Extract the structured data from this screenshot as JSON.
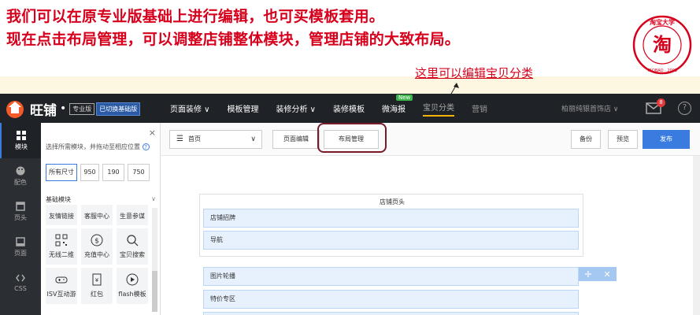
{
  "slide": {
    "line1": "我们可以在原专业版基础上进行编辑，也可买模板套用。",
    "line2": "现在点击布局管理，可以调整店铺整体模块，管理店铺的大致布局。",
    "annotation": "这里可以编辑宝贝分类",
    "seal_text_top": "淘宝大学",
    "seal_text_side": "UNIVERSITY",
    "seal_text_bottom": "TAOBAO · 2003",
    "seal_char": "淘"
  },
  "topnav": {
    "logo": "旺铺",
    "dot": "•",
    "tag_pro": "专业版",
    "tag_base": "已切换基础版",
    "items": [
      {
        "label": "页面装修 ∨"
      },
      {
        "label": "模板管理"
      },
      {
        "label": "装修分析 ∨"
      },
      {
        "label": "装修模板"
      },
      {
        "label": "微海报",
        "badge": "New"
      },
      {
        "label": "宝贝分类"
      },
      {
        "label": "营销"
      }
    ],
    "shop_name": "柏丽纯银首饰店 ∨",
    "mail_count": "8",
    "help": "?"
  },
  "rail": {
    "items": [
      {
        "label": "模块",
        "icon": "grid-icon"
      },
      {
        "label": "配色",
        "icon": "palette-icon"
      },
      {
        "label": "页头",
        "icon": "header-icon"
      },
      {
        "label": "页面",
        "icon": "page-icon"
      },
      {
        "label": "CSS",
        "icon": "code-icon"
      }
    ]
  },
  "panel": {
    "close": "×",
    "hint": "选择所需模块，并拖动至相应位置",
    "hint_icon": "?",
    "sizes": [
      "所有尺寸",
      "950",
      "190",
      "750"
    ],
    "category": "基础模块",
    "cells": [
      {
        "label": "友情链接",
        "icon": ""
      },
      {
        "label": "客服中心",
        "icon": ""
      },
      {
        "label": "生意参谋",
        "icon": ""
      },
      {
        "label": "无线二维",
        "icon": "qrcode-icon"
      },
      {
        "label": "充值中心",
        "icon": "coin-icon"
      },
      {
        "label": "宝贝搜索",
        "icon": "search-icon"
      },
      {
        "label": "ISV互动游",
        "icon": "gamepad-icon"
      },
      {
        "label": "红包",
        "icon": "redpacket-icon"
      },
      {
        "label": "flash模板",
        "icon": "play-icon"
      }
    ]
  },
  "toolbar": {
    "page_select": "首页",
    "page_edit": "页面编辑",
    "layout_manage": "布局管理",
    "backup": "备份",
    "preview": "预览",
    "publish": "发布"
  },
  "canvas": {
    "head_label": "店铺页头",
    "head_modules": [
      "店铺招牌",
      "导航"
    ],
    "body_modules": [
      "图片轮播",
      "特价专区",
      ""
    ],
    "tools": [
      "✛",
      "✕"
    ]
  },
  "colors": {
    "slide_red": "#d6001c",
    "nav_bg": "#1f2226",
    "accent_blue": "#3a7be0",
    "module_bg": "#e7f1fd",
    "highlight_circle": "#7a1a28"
  }
}
